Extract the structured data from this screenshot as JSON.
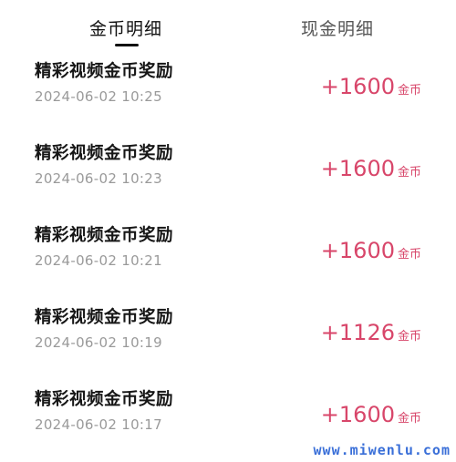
{
  "tabs": [
    {
      "label": "金币明细",
      "active": true
    },
    {
      "label": "现金明细",
      "active": false
    }
  ],
  "records": [
    {
      "title": "精彩视频金币奖励",
      "time": "2024-06-02 10:25",
      "amount": "+1600",
      "unit": "金币"
    },
    {
      "title": "精彩视频金币奖励",
      "time": "2024-06-02 10:23",
      "amount": "+1600",
      "unit": "金币"
    },
    {
      "title": "精彩视频金币奖励",
      "time": "2024-06-02 10:21",
      "amount": "+1600",
      "unit": "金币"
    },
    {
      "title": "精彩视频金币奖励",
      "time": "2024-06-02 10:19",
      "amount": "+1126",
      "unit": "金币"
    },
    {
      "title": "精彩视频金币奖励",
      "time": "2024-06-02 10:17",
      "amount": "+1600",
      "unit": "金币"
    }
  ],
  "watermark": "www.miwenlu.com",
  "colors": {
    "amount": "#d8466a",
    "watermark": "#3a6fd8"
  }
}
